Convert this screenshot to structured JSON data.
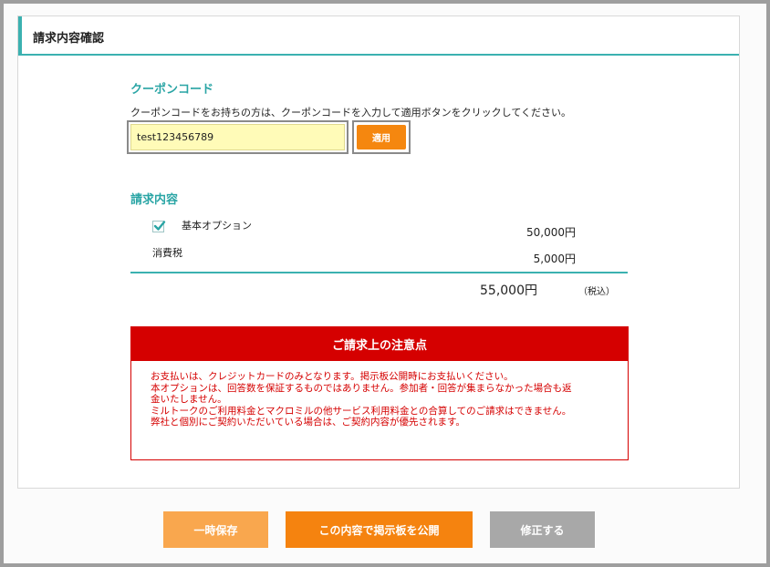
{
  "panel": {
    "title": "請求内容確認"
  },
  "coupon": {
    "title": "クーポンコード",
    "description": "クーポンコードをお持ちの方は、クーポンコードを入力して適用ボタンをクリックしてください。",
    "value": "test123456789",
    "apply_label": "適用"
  },
  "billing": {
    "title": "請求内容",
    "items": [
      {
        "label": "基本オプション",
        "amount": "50,000円",
        "checked": true
      },
      {
        "label": "消費税",
        "amount": "5,000円"
      }
    ],
    "total": "55,000円",
    "total_note": "（税込）"
  },
  "notice": {
    "title": "ご請求上の注意点",
    "lines": [
      "お支払いは、クレジットカードのみとなります。掲示板公開時にお支払いください。",
      "本オプションは、回答数を保証するものではありません。参加者・回答が集まらなかった場合も返",
      "金いたしません。",
      "ミルトークのご利用料金とマクロミルの他サービス利用料金との合算してのご請求はできません。",
      "弊社と個別にご契約いただいている場合は、ご契約内容が優先されます。"
    ]
  },
  "buttons": {
    "save": "一時保存",
    "publish": "この内容で掲示板を公開",
    "edit": "修正する"
  },
  "colors": {
    "accent": "#3bb1b0",
    "orange": "#f5830f",
    "warning_red": "#d50000",
    "coupon_bg": "#fffbb8",
    "grey_button": "#a8a8a8"
  }
}
